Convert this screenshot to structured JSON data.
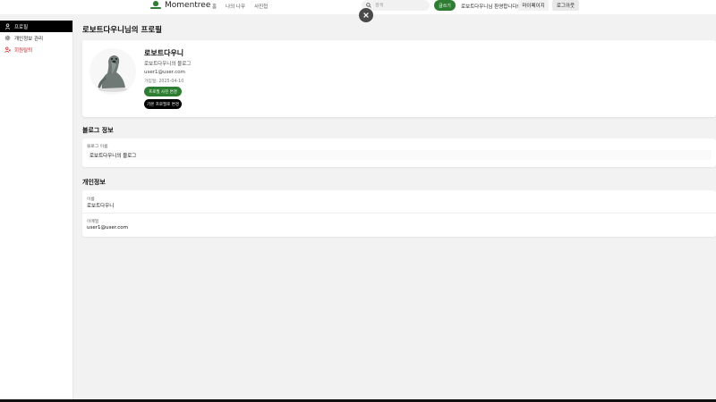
{
  "header": {
    "logo_text": "Momentree",
    "nav": [
      "홈",
      "나의 나무",
      "사진첩"
    ],
    "search_placeholder": "검색",
    "write_label": "글쓰기",
    "welcome": "로보트다우니님 환영합니다!",
    "mypage_label": "마이페이지",
    "logout_label": "로그아웃"
  },
  "sidebar": {
    "items": [
      {
        "label": "프로필",
        "icon": "user-icon",
        "active": true
      },
      {
        "label": "개인정보 관리",
        "icon": "gear-icon",
        "active": false
      },
      {
        "label": "회원탈퇴",
        "icon": "user-remove-icon",
        "active": false
      }
    ]
  },
  "main": {
    "title": "로보트다우니님의 프로필",
    "profile": {
      "name": "로보트다우니",
      "blog": "로보트다우니의 블로그",
      "email": "user1@user.com",
      "joined": "가입일: 2025-04-10",
      "change_photo_label": "프로필 사진 변경",
      "default_photo_label": "기본 프로필로 변경"
    },
    "blog_section": {
      "title": "블로그 정보",
      "label": "블로그 이름",
      "value": "로보트다우니의 블로그"
    },
    "personal_section": {
      "title": "개인정보",
      "name_label": "이름",
      "name_value": "로보트다우니",
      "email_label": "이메일",
      "email_value": "user1@user.com"
    }
  },
  "colors": {
    "accent": "#2e7d32",
    "danger": "#c62828",
    "sidebar_active": "#000000"
  }
}
